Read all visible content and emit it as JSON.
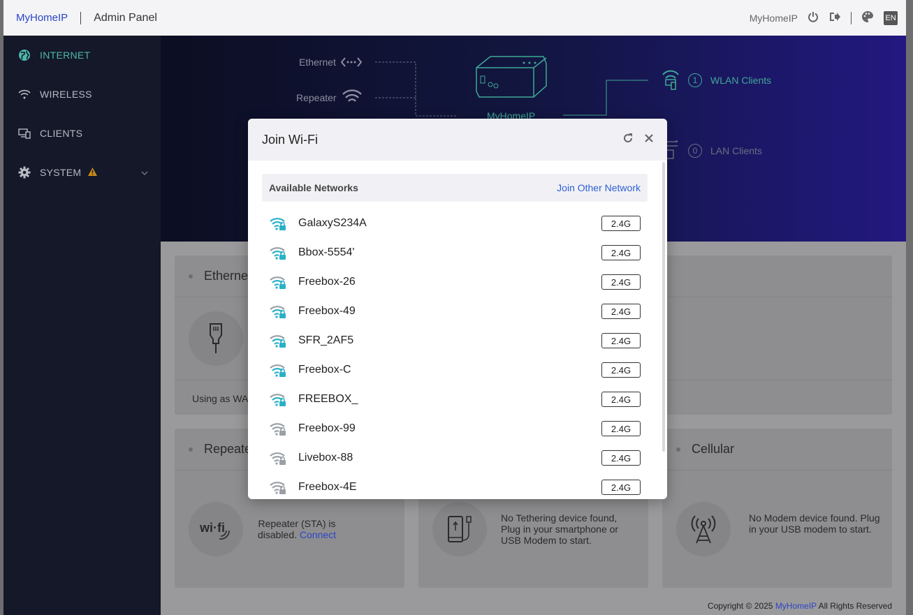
{
  "topbar": {
    "brand": "MyHomeIP",
    "title": "Admin Panel",
    "user": "MyHomeIP",
    "lang": "EN"
  },
  "sidebar": {
    "items": [
      {
        "label": "INTERNET",
        "icon": "globe-icon",
        "active": true
      },
      {
        "label": "WIRELESS",
        "icon": "wifi-icon",
        "active": false
      },
      {
        "label": "CLIENTS",
        "icon": "devices-icon",
        "active": false
      },
      {
        "label": "SYSTEM",
        "icon": "gear-icon",
        "active": false
      }
    ]
  },
  "hero": {
    "ethernet": "Ethernet",
    "repeater": "Repeater",
    "router": "MyHomeIP",
    "wlan_count": "1",
    "wlan_label": "WLAN Clients",
    "lan_count": "0",
    "lan_label": "LAN Clients"
  },
  "cards": {
    "ethernet_title": "Ethernet",
    "ethernet_foot": "Using as WAN",
    "repeater_title": "Repeater",
    "repeater_text": "Repeater (STA) is disabled.",
    "repeater_link": "Connect",
    "tethering_text": "No Tethering device found, Plug in your smartphone or USB Modem to start.",
    "cellular_title": "Cellular",
    "cellular_text": "No Modem device found. Plug in your USB modem to start."
  },
  "footer": {
    "prefix": "Copyright © 2025",
    "brand": "MyHomeIP",
    "suffix": "All Rights Reserved"
  },
  "modal": {
    "title": "Join Wi-Fi",
    "section": "Available Networks",
    "join_other": "Join Other Network",
    "networks": [
      {
        "name": "GalaxyS234A",
        "band": "2.4G",
        "strength": "strong"
      },
      {
        "name": "Bbox-5554'",
        "band": "2.4G",
        "strength": "medium"
      },
      {
        "name": "Freebox-26",
        "band": "2.4G",
        "strength": "medium"
      },
      {
        "name": "Freebox-49",
        "band": "2.4G",
        "strength": "medium"
      },
      {
        "name": "SFR_2AF5",
        "band": "2.4G",
        "strength": "medium"
      },
      {
        "name": "Freebox-C",
        "band": "2.4G",
        "strength": "medium"
      },
      {
        "name": "FREEBOX_",
        "band": "2.4G",
        "strength": "medium"
      },
      {
        "name": "Freebox-99",
        "band": "2.4G",
        "strength": "weak"
      },
      {
        "name": "Livebox-88",
        "band": "2.4G",
        "strength": "weak"
      },
      {
        "name": "Freebox-4E",
        "band": "2.4G",
        "strength": "weak"
      }
    ]
  },
  "colors": {
    "accent": "#3fa896",
    "brand": "#2d45c6",
    "wifi_strong": "#2ab0c8",
    "wifi_weak": "#9aa0a6"
  }
}
